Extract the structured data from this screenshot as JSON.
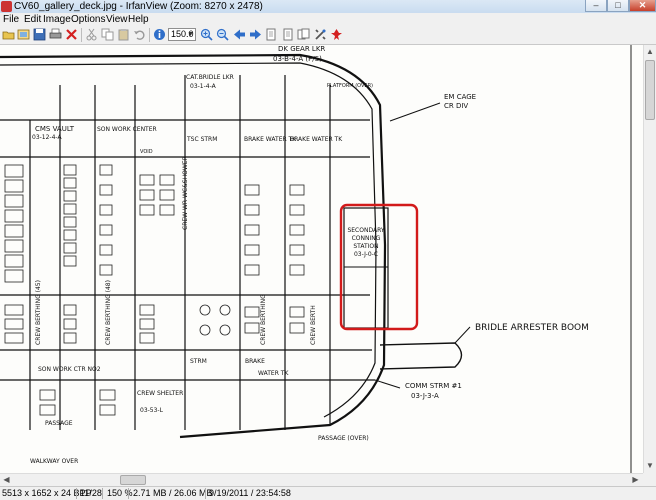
{
  "window": {
    "title": "CV60_gallery_deck.jpg - IrfanView (Zoom: 8270 x 2478)",
    "minimize": "–",
    "maximize": "□",
    "close": "✕"
  },
  "menu": [
    "File",
    "Edit",
    "Image",
    "Options",
    "View",
    "Help"
  ],
  "toolbar": {
    "zoom_value": "150.0",
    "icons": [
      "open-folder-icon",
      "slideshow-icon",
      "save-icon",
      "print-icon",
      "delete-icon",
      "cut-icon",
      "copy-icon",
      "paste-icon",
      "undo-icon",
      "info-icon",
      "zoom-in-icon",
      "zoom-out-icon",
      "previous-icon",
      "next-icon",
      "first-page-icon",
      "last-page-icon",
      "copy-page-icon",
      "settings-icon",
      "exit-icon"
    ]
  },
  "status": {
    "image_info": "5513 x 1652 x 24 BPP",
    "index": "11/28",
    "zoom": "150 %",
    "memory": "2.71 MB / 26.06 MB",
    "datetime": "9/19/2011 / 23:54:58"
  },
  "drawing": {
    "labels": {
      "dk_gear": "DK GEAR LKR",
      "dk_gear_no": "03-B-4-A (P/S)",
      "cat_bridle": "CAT.BRIDLE LKR",
      "cat_bridle_no": "03-1-4-A",
      "platform": "PLATFORM (OVER)",
      "em_cage": "EM CAGE",
      "cr_div": "CR DIV",
      "cms_vault": "CMS VAULT",
      "cms_no": "03-12-4-A",
      "son_work": "SON WORK CENTER",
      "tsc_strm": "TSC STRM",
      "brake_water": "BRAKE WATER TK",
      "brake_water2": "BRAKE WATER TK",
      "crew_wr": "CREW WR WC&SHOWER",
      "crew_berthing_45": "CREW BERTHING (45)",
      "crew_berthing_48": "CREW BERTHING (48)",
      "crew_berthing_a": "CREW BERTHING",
      "crew_berth": "CREW BERTH",
      "crew_shelter": "CREW SHELTER",
      "crew_shelter_no": "03-53-L",
      "son_work2": "SON WORK CTR NO2",
      "comm_strm": "COMM STRM #1",
      "comm_strm_no": "03-J-3-A",
      "bridle_arrester": "BRIDLE ARRESTER BOOM",
      "passage": "PASSAGE",
      "passage_over": "PASSAGE (OVER)",
      "void": "VOID",
      "brake": "BRAKE",
      "water_tk": "WATER TK",
      "strm": "STRM",
      "walkway": "WALKWAY OVER"
    },
    "secondary_conning": [
      "SECONDARY",
      "CONNING",
      "STATION",
      "03-J-0-C"
    ]
  }
}
